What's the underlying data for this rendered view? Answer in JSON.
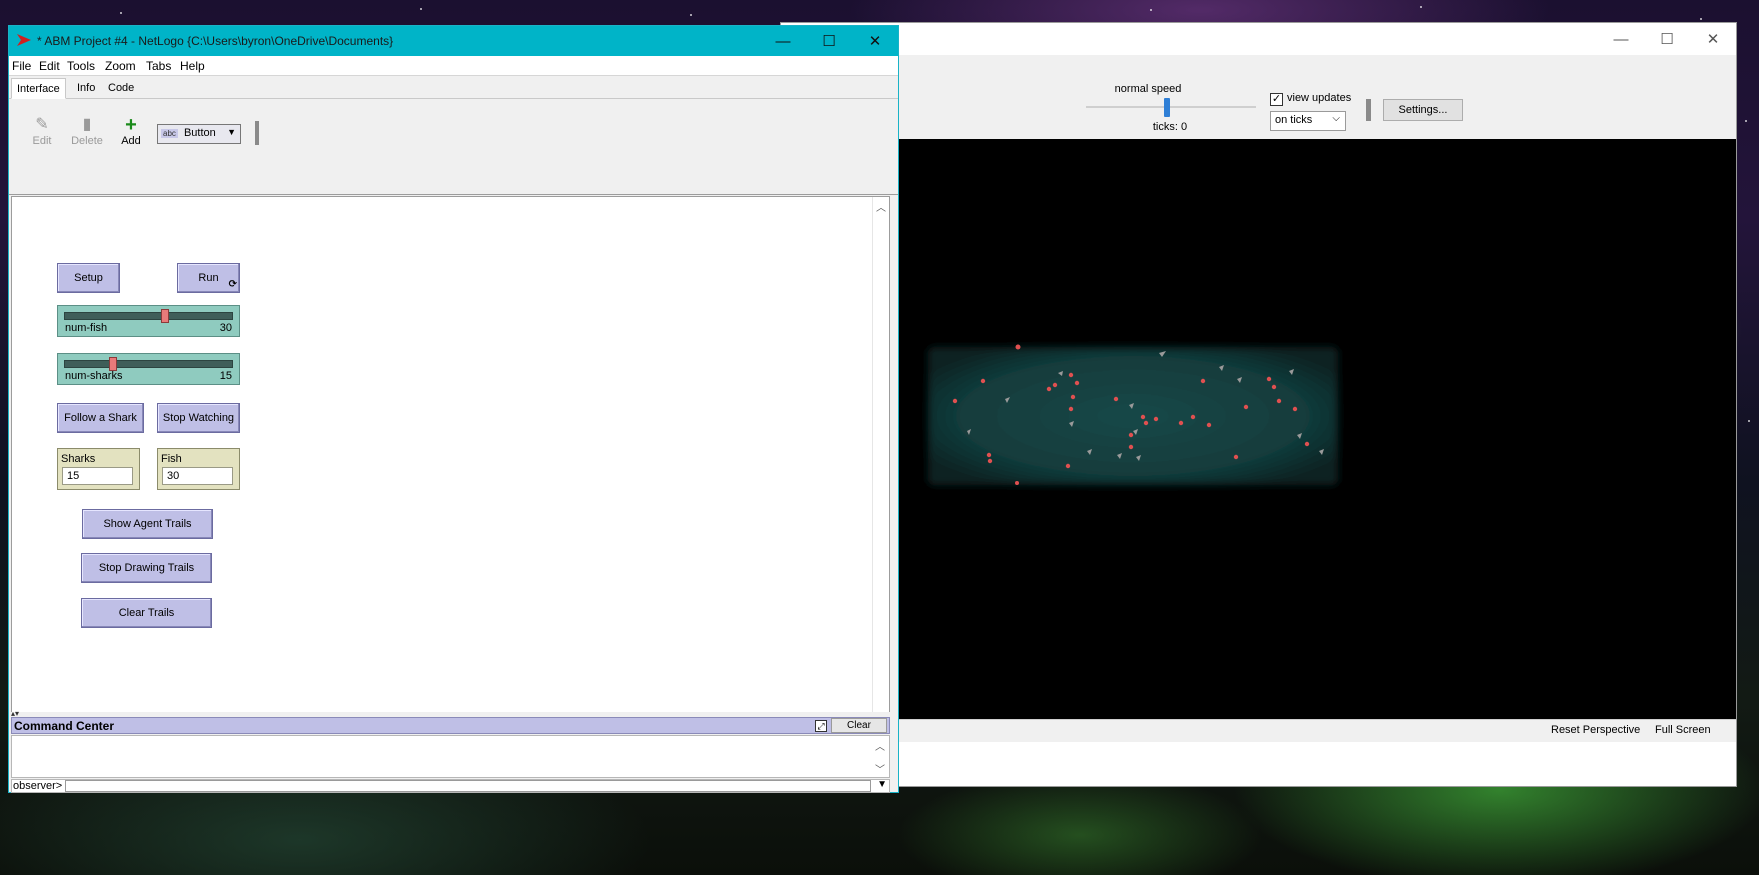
{
  "view_window": {
    "speed_label": "normal speed",
    "ticks_label": "ticks: 0",
    "view_updates_checked": "✓",
    "view_updates_label": "view updates",
    "update_mode": "on ticks",
    "settings_label": "Settings...",
    "reset_perspective_label": "Reset Perspective",
    "full_screen_label": "Full Screen",
    "world_color": "#0f3a3a"
  },
  "main_window": {
    "title": "* ABM Project #4 - NetLogo {C:\\Users\\byron\\OneDrive\\Documents}",
    "menu": [
      "File",
      "Edit",
      "Tools",
      "Zoom",
      "Tabs",
      "Help"
    ],
    "tabs": [
      "Interface",
      "Info",
      "Code"
    ],
    "toolbar": {
      "edit_label": "Edit",
      "delete_label": "Delete",
      "add_label": "Add",
      "widget_type": "Button",
      "widget_type_badge": "abc"
    }
  },
  "widgets": {
    "setup_label": "Setup",
    "run_label": "Run",
    "num_fish": {
      "label": "num-fish",
      "value": "30",
      "fraction": 0.6
    },
    "num_sharks": {
      "label": "num-sharks",
      "value": "15",
      "fraction": 0.28
    },
    "follow_shark_label": "Follow a Shark",
    "stop_watching_label": "Stop Watching",
    "sharks_monitor": {
      "label": "Sharks",
      "value": "15"
    },
    "fish_monitor": {
      "label": "Fish",
      "value": "30"
    },
    "show_trails_label": "Show Agent Trails",
    "stop_trails_label": "Stop Drawing Trails",
    "clear_trails_label": "Clear Trails"
  },
  "command_center": {
    "title": "Command Center",
    "clear_label": "Clear",
    "observer_label": "observer>"
  },
  "colors": {
    "titlebar_accent": "#00b4c8",
    "button": "#bfbfe6",
    "slider": "#8fcbbf",
    "monitor": "#e3e2c0",
    "fish": "#e05050",
    "shark": "#9a9a9a"
  }
}
